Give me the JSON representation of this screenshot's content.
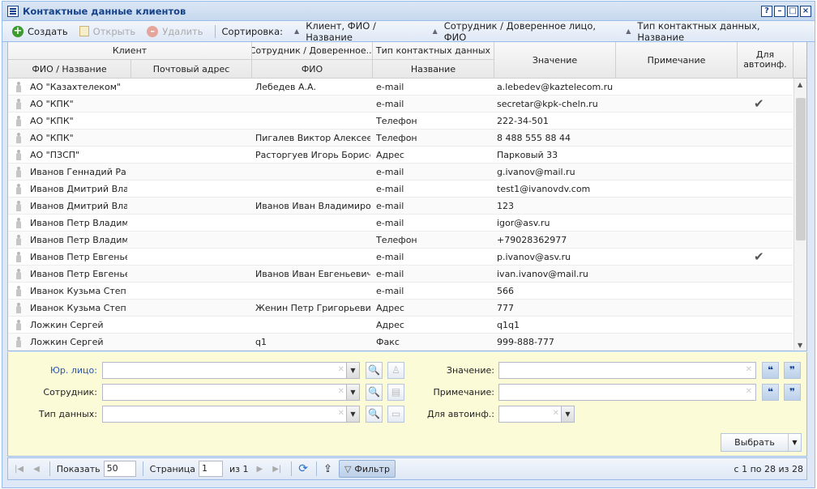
{
  "window": {
    "title": "Контактные данные клиентов",
    "buttons": [
      "?",
      "–",
      "□",
      "×"
    ]
  },
  "toolbar": {
    "create": "Создать",
    "open": "Открыть",
    "delete": "Удалить",
    "sort_label": "Сортировка:",
    "sort1": "Клиент, ФИО / Название",
    "sort2": "Сотрудник / Доверенное лицо, ФИО",
    "sort3": "Тип контактных данных, Название"
  },
  "grid": {
    "group_client": "Клиент",
    "group_employee": "Сотрудник / Доверенное...",
    "group_type": "Тип контактных данных",
    "col_name": "ФИО / Название",
    "col_postal": "Почтовый адрес",
    "col_fio": "ФИО",
    "col_typename": "Название",
    "col_value": "Значение",
    "col_note": "Примечание",
    "col_auto1": "Для",
    "col_auto2": "автоинф.",
    "rows": [
      {
        "client": "АО \"Казахтелеком\"",
        "employee": "Лебедев А.А.",
        "type": "e-mail",
        "value": "a.lebedev@kaztelecom.ru",
        "auto": ""
      },
      {
        "client": "АО \"КПК\"",
        "employee": "",
        "type": "e-mail",
        "value": "secretar@kpk-cheln.ru",
        "auto": "✔"
      },
      {
        "client": "АО \"КПК\"",
        "employee": "",
        "type": "Телефон",
        "value": "222-34-501",
        "auto": ""
      },
      {
        "client": "АО \"КПК\"",
        "employee": "Пигалев Виктор Алексее...",
        "type": "Телефон",
        "value": "8 488 555 88 44",
        "auto": ""
      },
      {
        "client": "АО \"ПЗСП\"",
        "employee": "Расторгуев Игорь Борисо...",
        "type": "Адрес",
        "value": "Парковый 33",
        "auto": ""
      },
      {
        "client": "Иванов Геннадий Ра...",
        "employee": "",
        "type": "e-mail",
        "value": "g.ivanov@mail.ru",
        "auto": ""
      },
      {
        "client": "Иванов Дмитрий Вла...",
        "employee": "",
        "type": "e-mail",
        "value": "test1@ivanovdv.com",
        "auto": ""
      },
      {
        "client": "Иванов Дмитрий Вла...",
        "employee": "Иванов Иван Владимиро...",
        "type": "e-mail",
        "value": "123",
        "auto": ""
      },
      {
        "client": "Иванов Петр Владим...",
        "employee": "",
        "type": "e-mail",
        "value": "igor@asv.ru",
        "auto": ""
      },
      {
        "client": "Иванов Петр Владим...",
        "employee": "",
        "type": "Телефон",
        "value": "+79028362977",
        "auto": ""
      },
      {
        "client": "Иванов Петр Евгенье...",
        "employee": "",
        "type": "e-mail",
        "value": "p.ivanov@asv.ru",
        "auto": "✔"
      },
      {
        "client": "Иванов Петр Евгенье...",
        "employee": "Иванов Иван Евгеньевич",
        "type": "e-mail",
        "value": "ivan.ivanov@mail.ru",
        "auto": ""
      },
      {
        "client": "Иванок Кузьма Степ...",
        "employee": "",
        "type": "e-mail",
        "value": "566",
        "auto": ""
      },
      {
        "client": "Иванок Кузьма Степ...",
        "employee": "Женин Петр Григорьевич",
        "type": "Адрес",
        "value": "777",
        "auto": ""
      },
      {
        "client": "Ложкин Сергей",
        "employee": "",
        "type": "Адрес",
        "value": "q1q1",
        "auto": ""
      },
      {
        "client": "Ложкин Сергей",
        "employee": "q1",
        "type": "Факс",
        "value": "999-888-777",
        "auto": ""
      }
    ]
  },
  "filter": {
    "legal_label": "Юр. лицо:",
    "employee_label": "Сотрудник:",
    "datatype_label": "Тип данных:",
    "value_label": "Значение:",
    "note_label": "Примечание:",
    "auto_label": "Для автоинф.:",
    "select_button": "Выбрать"
  },
  "pager": {
    "show_label": "Показать",
    "page_size": "50",
    "page_label": "Страница",
    "page": "1",
    "of": "из 1",
    "filter_button": "Фильтр",
    "info": "с 1 по 28 из 28"
  }
}
